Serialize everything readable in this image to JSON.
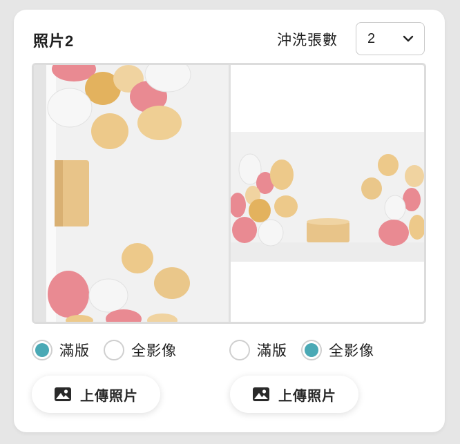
{
  "header": {
    "title": "照片2",
    "count_label": "沖洗張數",
    "count_value": "2"
  },
  "left": {
    "options": [
      {
        "label": "滿版",
        "selected": true
      },
      {
        "label": "全影像",
        "selected": false
      }
    ],
    "upload_label": "上傳照片"
  },
  "right": {
    "options": [
      {
        "label": "滿版",
        "selected": false
      },
      {
        "label": "全影像",
        "selected": true
      }
    ],
    "upload_label": "上傳照片"
  },
  "colors": {
    "accent": "#4aa9b5",
    "balloon_gold": "#e8c27a",
    "balloon_pink": "#e98a92",
    "balloon_white": "#f4f4f4",
    "podium": "#e8c489"
  },
  "icons": {
    "dropdown": "chevron-down-icon",
    "upload": "image-icon"
  }
}
